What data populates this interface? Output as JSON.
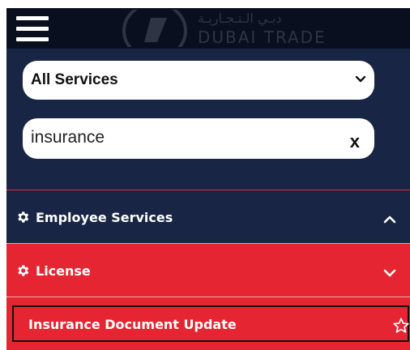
{
  "header": {
    "logo_text_en": "DUBAI TRADE",
    "logo_text_ar": "دبـي الـتـجـاريـة"
  },
  "search": {
    "category_value": "All Services",
    "query_value": "insurance",
    "clear_label": "x"
  },
  "accordion": {
    "sections": [
      {
        "label": "Employee Services",
        "expanded": false,
        "icon": "gear-icon",
        "chevron": "chevron-up-icon"
      },
      {
        "label": "License",
        "expanded": true,
        "icon": "gear-icon",
        "chevron": "chevron-down-icon",
        "items": [
          {
            "label": "Insurance Document Update",
            "icon": "star-outline-icon"
          }
        ]
      }
    ]
  },
  "colors": {
    "header_bg": "#0a0f1f",
    "panel_bg": "#182544",
    "accent_red": "#e52632"
  }
}
